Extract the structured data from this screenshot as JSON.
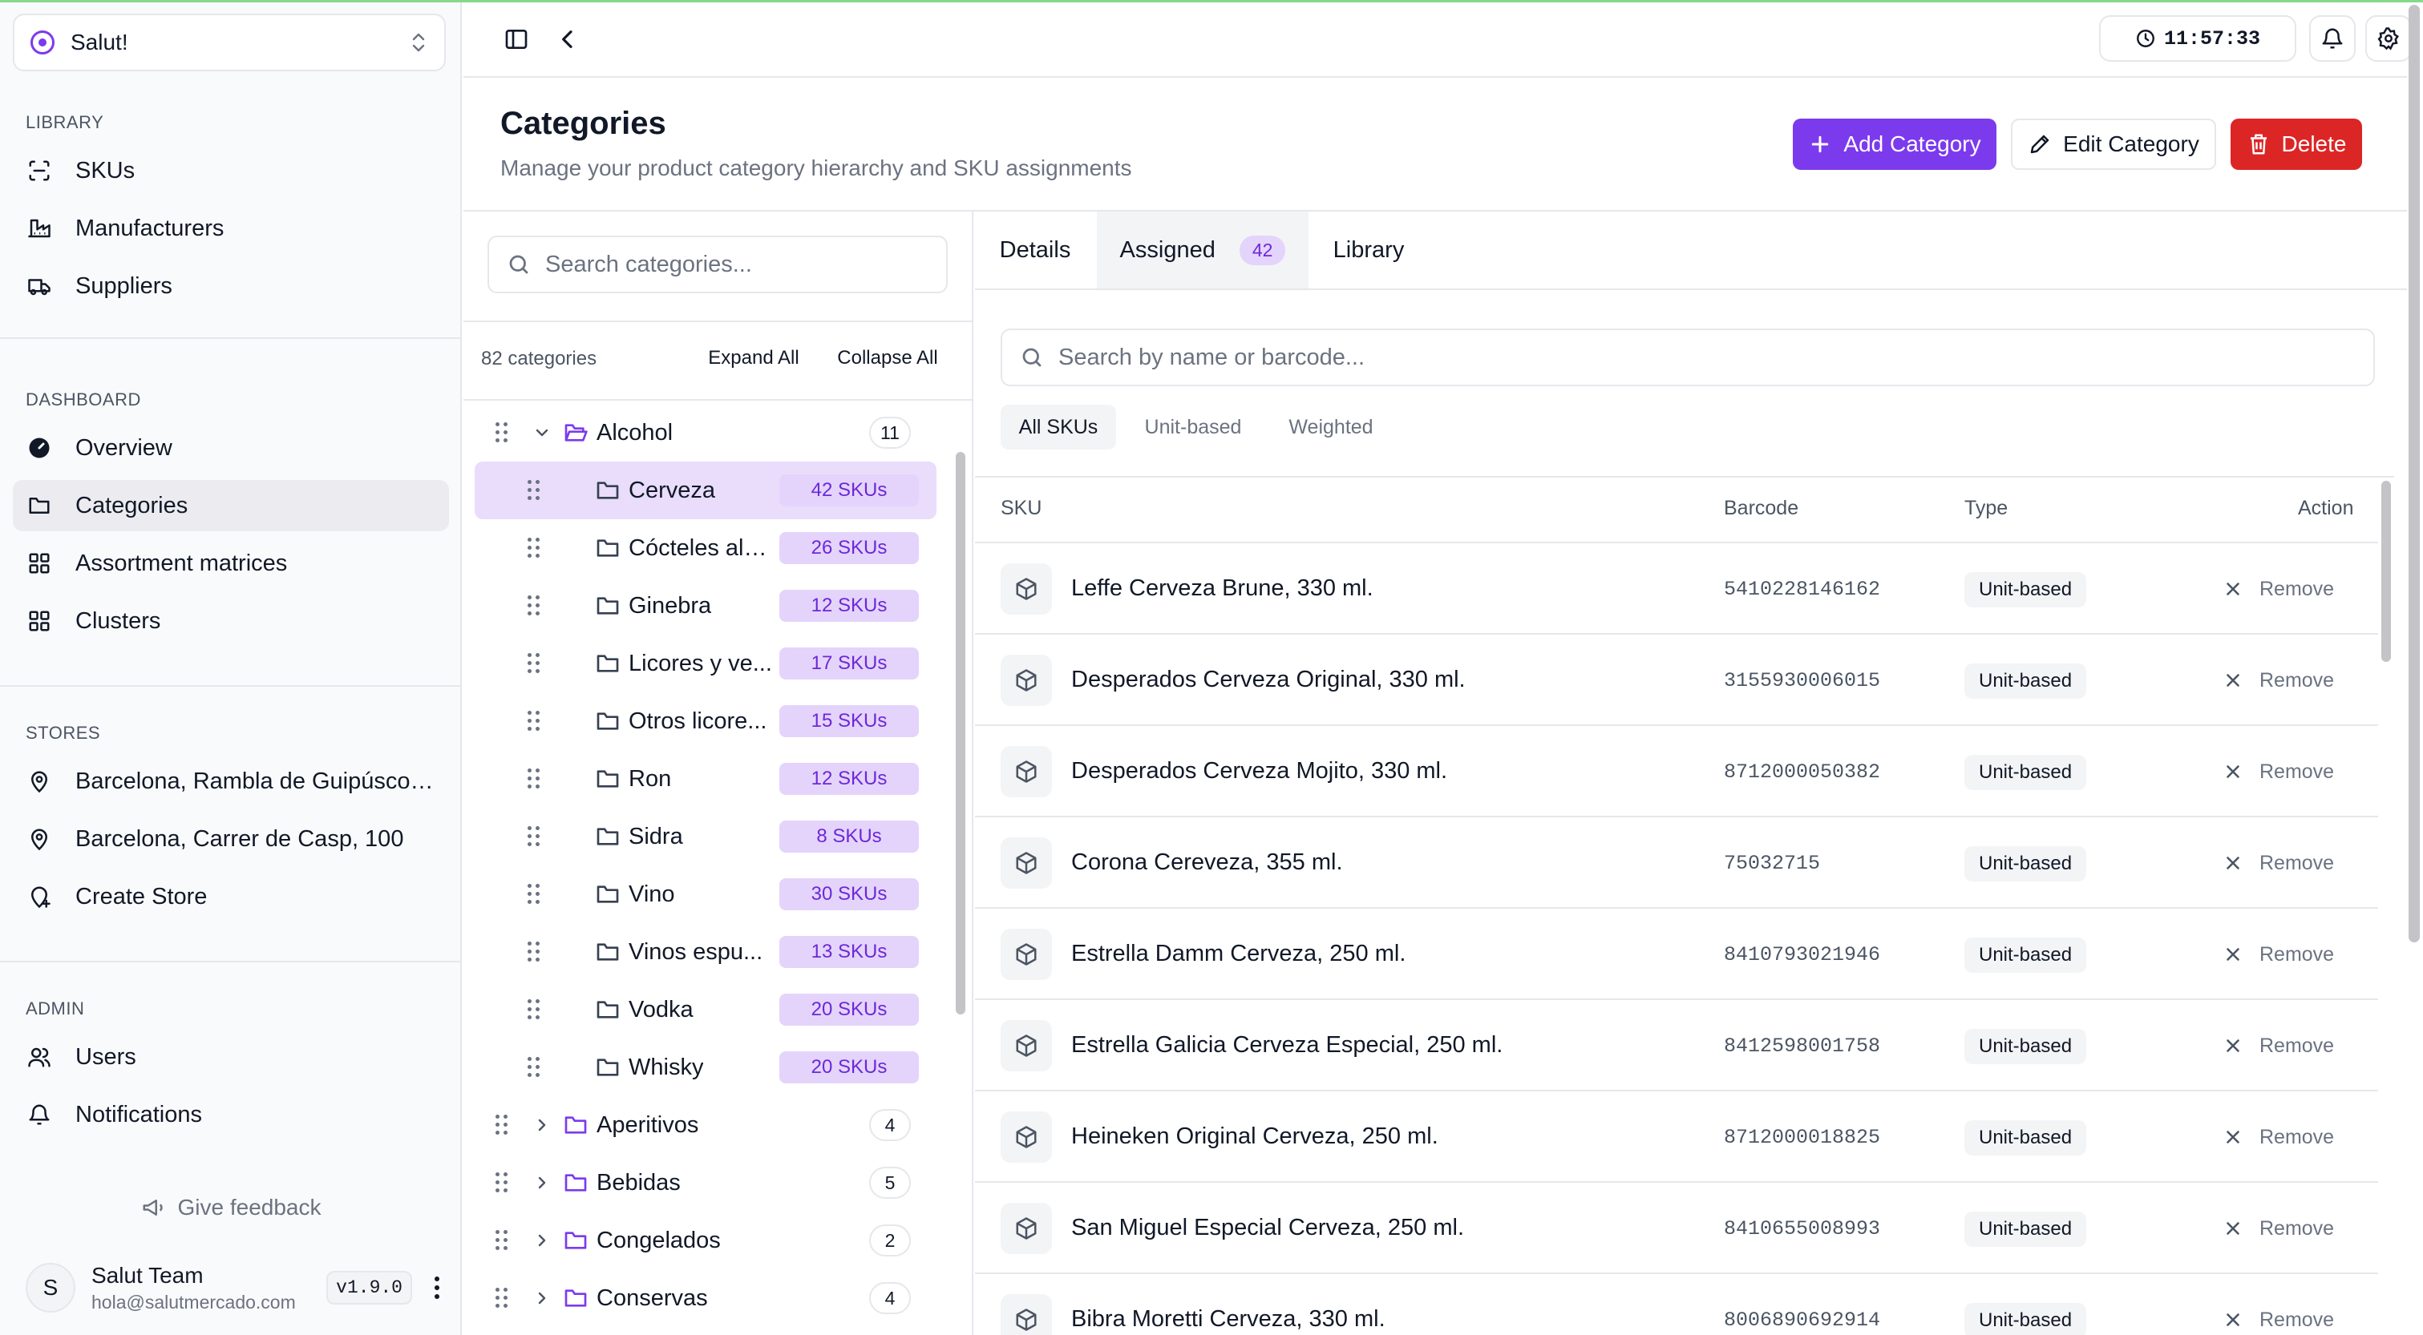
{
  "org": {
    "name": "Salut!"
  },
  "sidebar": {
    "library": {
      "heading": "LIBRARY",
      "items": [
        {
          "label": "SKUs",
          "icon": "scan-icon"
        },
        {
          "label": "Manufacturers",
          "icon": "factory-icon"
        },
        {
          "label": "Suppliers",
          "icon": "truck-icon"
        }
      ]
    },
    "dashboard": {
      "heading": "DASHBOARD",
      "items": [
        {
          "label": "Overview",
          "icon": "gauge-icon"
        },
        {
          "label": "Categories",
          "icon": "folder-icon"
        },
        {
          "label": "Assortment matrices",
          "icon": "grid-icon"
        },
        {
          "label": "Clusters",
          "icon": "grid-icon"
        }
      ]
    },
    "stores": {
      "heading": "STORES",
      "items": [
        {
          "label": "Barcelona, Rambla de Guipúscoa,...",
          "icon": "map-pin-icon"
        },
        {
          "label": "Barcelona, Carrer de Casp, 100",
          "icon": "map-pin-icon"
        },
        {
          "label": "Create Store",
          "icon": "map-pin-plus-icon"
        }
      ]
    },
    "admin": {
      "heading": "ADMIN",
      "items": [
        {
          "label": "Users",
          "icon": "users-icon"
        },
        {
          "label": "Notifications",
          "icon": "bell-icon"
        }
      ]
    },
    "feedback": "Give feedback",
    "user": {
      "initial": "S",
      "name": "Salut Team",
      "email": "hola@salutmercado.com",
      "version": "v1.9.0"
    }
  },
  "topbar": {
    "time": "11:57:33"
  },
  "header": {
    "title": "Categories",
    "subtitle": "Manage your product category hierarchy and SKU assignments",
    "add_label": "Add Category",
    "edit_label": "Edit Category",
    "delete_label": "Delete"
  },
  "tree": {
    "search_placeholder": "Search categories...",
    "count_text": "82 categories",
    "expand_all": "Expand All",
    "collapse_all": "Collapse All",
    "root_alcohol": {
      "label": "Alcohol",
      "count": "11"
    },
    "children": [
      {
        "label": "Cerveza",
        "badge": "42 SKUs"
      },
      {
        "label": "Cócteles alc...",
        "badge": "26 SKUs"
      },
      {
        "label": "Ginebra",
        "badge": "12 SKUs"
      },
      {
        "label": "Licores y ve...",
        "badge": "17 SKUs"
      },
      {
        "label": "Otros licore...",
        "badge": "15 SKUs"
      },
      {
        "label": "Ron",
        "badge": "12 SKUs"
      },
      {
        "label": "Sidra",
        "badge": "8 SKUs"
      },
      {
        "label": "Vino",
        "badge": "30 SKUs"
      },
      {
        "label": "Vinos espu...",
        "badge": "13 SKUs"
      },
      {
        "label": "Vodka",
        "badge": "20 SKUs"
      },
      {
        "label": "Whisky",
        "badge": "20 SKUs"
      }
    ],
    "roots": [
      {
        "label": "Aperitivos",
        "count": "4"
      },
      {
        "label": "Bebidas",
        "count": "5"
      },
      {
        "label": "Congelados",
        "count": "2"
      },
      {
        "label": "Conservas",
        "count": "4"
      }
    ]
  },
  "tabs": {
    "details": "Details",
    "assigned": "Assigned",
    "assigned_count": "42",
    "library": "Library"
  },
  "sku_search_placeholder": "Search by name or barcode...",
  "filters": {
    "all": "All SKUs",
    "unit": "Unit-based",
    "weighted": "Weighted"
  },
  "table": {
    "columns": {
      "sku": "SKU",
      "barcode": "Barcode",
      "type": "Type",
      "action": "Action"
    },
    "remove_label": "Remove",
    "rows": [
      {
        "name": "Leffe Cerveza Brune, 330 ml.",
        "barcode": "5410228146162",
        "type": "Unit-based"
      },
      {
        "name": "Desperados Cerveza Original, 330 ml.",
        "barcode": "3155930006015",
        "type": "Unit-based"
      },
      {
        "name": "Desperados Cerveza Mojito, 330 ml.",
        "barcode": "8712000050382",
        "type": "Unit-based"
      },
      {
        "name": "Corona Cereveza, 355 ml.",
        "barcode": "75032715",
        "type": "Unit-based"
      },
      {
        "name": "Estrella Damm Cerveza, 250 ml.",
        "barcode": "8410793021946",
        "type": "Unit-based"
      },
      {
        "name": "Estrella Galicia Cerveza Especial, 250 ml.",
        "barcode": "8412598001758",
        "type": "Unit-based"
      },
      {
        "name": "Heineken Original Cerveza, 250 ml.",
        "barcode": "8712000018825",
        "type": "Unit-based"
      },
      {
        "name": "San Miguel Especial Cerveza, 250 ml.",
        "barcode": "8410655008993",
        "type": "Unit-based"
      },
      {
        "name": "Bibra Moretti Cerveza, 330 ml.",
        "barcode": "8006890692914",
        "type": "Unit-based"
      }
    ]
  },
  "colors": {
    "accent": "#7c3aed",
    "danger": "#dc2626",
    "badge_bg": "#e4d4fb",
    "selected_row": "#e9ddfb"
  }
}
